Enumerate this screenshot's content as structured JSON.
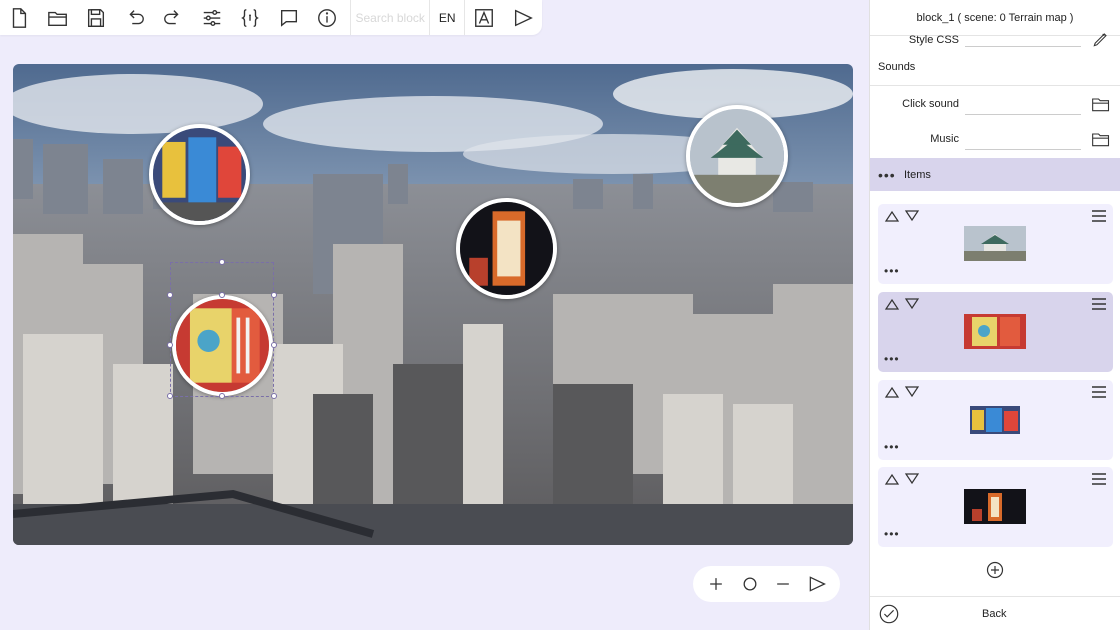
{
  "toolbar": {
    "icons": [
      "new-file-icon",
      "open-folder-icon",
      "save-icon",
      "undo-icon",
      "redo-icon",
      "settings-sliders-icon",
      "code-braces-icon",
      "comment-icon",
      "info-icon"
    ],
    "search_placeholder": "Search block",
    "language": "EN",
    "extra_icons": [
      "font-style-icon",
      "play-icon"
    ]
  },
  "panel": {
    "title": "block_1 ( scene: 0 Terrain map )",
    "style_css_label": "Style CSS",
    "sounds_label": "Sounds",
    "click_sound_label": "Click sound",
    "music_label": "Music",
    "items_label": "Items",
    "items": [
      {
        "thumb": "castle",
        "active": false
      },
      {
        "thumb": "manga",
        "active": true
      },
      {
        "thumb": "billboard",
        "active": false
      },
      {
        "thumb": "night-sign",
        "active": false
      }
    ],
    "back_label": "Back"
  },
  "zoom": {
    "icons": [
      "zoom-in-icon",
      "reset-zoom-icon",
      "zoom-out-icon",
      "play-icon"
    ]
  }
}
